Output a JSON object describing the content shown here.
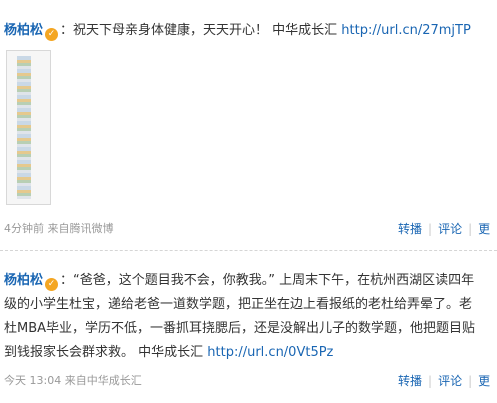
{
  "post1": {
    "author": "杨柏松",
    "badge": "✓",
    "colon": "：",
    "text": "祝天下母亲身体健康，天天开心！ 中华成长汇 ",
    "link": "http://url.cn/27mjTP",
    "meta": "4分钟前 来自腾讯微博",
    "actions": {
      "repost": "转播",
      "comment": "评论",
      "more": "更"
    }
  },
  "post2": {
    "author": "杨柏松",
    "badge": "✓",
    "colon": "：",
    "lines": [
      "“爸爸，这个题目我不会，你教我。” 上周末下午，在杭州西湖区读四年",
      "级的小学生杜宝，递给老爸一道数学题，把正坐在边上看报纸的老杜给弄晕了。老",
      "杜MBA毕业，学历不低，一番抓耳挠腮后，还是没解出儿子的数学题，他把题目贴",
      "到钱报家长会群求救。 中华成长汇 "
    ],
    "link": "http://url.cn/0Vt5Pz",
    "meta": "今天 13:04 来自中华成长汇",
    "actions": {
      "repost": "转播",
      "comment": "评论",
      "more": "更"
    }
  }
}
